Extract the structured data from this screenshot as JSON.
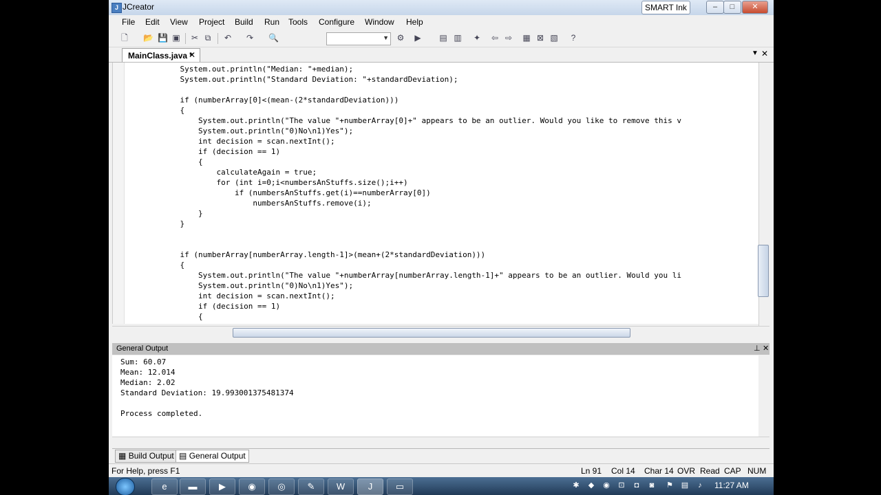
{
  "window": {
    "title": "JCreator",
    "smart_ink": "SMART Ink"
  },
  "menu": [
    "File",
    "Edit",
    "View",
    "Project",
    "Build",
    "Run",
    "Tools",
    "Configure",
    "Window",
    "Help"
  ],
  "tab": {
    "label": "MainClass.java *",
    "close": "✕"
  },
  "code_lines": [
    "            System.out.println(\"Median: \"+median);",
    "            System.out.println(\"Standard Deviation: \"+standardDeviation);",
    "",
    "            if (numberArray[0]<(mean-(2*standardDeviation)))",
    "            {",
    "                System.out.println(\"The value \"+numberArray[0]+\" appears to be an outlier. Would you like to remove this v",
    "                System.out.println(\"0)No\\n1)Yes\");",
    "                int decision = scan.nextInt();",
    "                if (decision == 1)",
    "                {",
    "                    calculateAgain = true;",
    "                    for (int i=0;i<numbersAnStuffs.size();i++)",
    "                        if (numbersAnStuffs.get(i)==numberArray[0])",
    "                            numbersAnStuffs.remove(i);",
    "                }",
    "            }",
    "",
    "",
    "            if (numberArray[numberArray.length-1]>(mean+(2*standardDeviation)))",
    "            {",
    "                System.out.println(\"The value \"+numberArray[numberArray.length-1]+\" appears to be an outlier. Would you li",
    "                System.out.println(\"0)No\\n1)Yes\");",
    "                int decision = scan.nextInt();",
    "                if (decision == 1)",
    "                {",
    "                    calculateAgain = true;",
    "                    for (int i=0;i<numbersAnStuffs.size();i++)"
  ],
  "output": {
    "title": "General Output",
    "lines": [
      "Sum: 60.07",
      "Mean: 12.014",
      "Median: 2.02",
      "Standard Deviation: 19.993001375481374",
      "",
      "Process completed."
    ]
  },
  "bottom_tabs": [
    "Build Output",
    "General Output"
  ],
  "status": {
    "help": "For Help, press F1",
    "ln": "Ln 91",
    "col": "Col 14",
    "char": "Char 14",
    "ovr": "OVR",
    "read": "Read",
    "cap": "CAP",
    "num": "NUM"
  },
  "taskbar": {
    "clock": "11:27 AM"
  },
  "icons": [
    "new-file-icon",
    "open-icon",
    "save-icon",
    "save-all-icon",
    "cut-icon",
    "copy-icon",
    "paste-icon",
    "undo-icon",
    "redo-icon",
    "find-icon",
    "run-icon",
    "compile-icon",
    "help-icon"
  ]
}
